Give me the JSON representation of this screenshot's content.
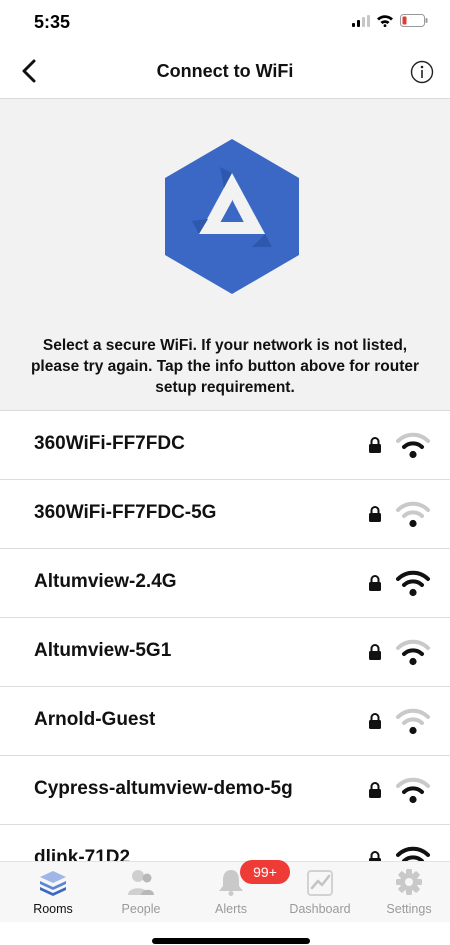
{
  "status_bar": {
    "time": "5:35",
    "icons": [
      "signal-icon",
      "wifi-status-icon",
      "battery-low-icon"
    ],
    "battery_color": "#e53935"
  },
  "nav": {
    "title": "Connect to WiFi",
    "back_icon": "chevron-left-icon",
    "info_icon": "info-circle-icon"
  },
  "hero": {
    "logo": "altumview-logo",
    "logo_color": "#3a68c4",
    "instructions": "Select a secure WiFi. If your network is not listed, please try again. Tap the info button above for router setup requirement."
  },
  "networks": [
    {
      "name": "360WiFi-FF7FDC",
      "secured": true,
      "signal": 0.66
    },
    {
      "name": "360WiFi-FF7FDC-5G",
      "secured": true,
      "signal": 0.33
    },
    {
      "name": "Altumview-2.4G",
      "secured": true,
      "signal": 1.0
    },
    {
      "name": "Altumview-5G1",
      "secured": true,
      "signal": 0.66
    },
    {
      "name": "Arnold-Guest",
      "secured": true,
      "signal": 0.33
    },
    {
      "name": "Cypress-altumview-demo-5g",
      "secured": true,
      "signal": 0.66
    },
    {
      "name": "dlink-71D2",
      "secured": true,
      "signal": 1.0
    }
  ],
  "tab_bar": {
    "tabs": [
      {
        "label": "Rooms",
        "icon": "rooms-layers-icon",
        "active": true
      },
      {
        "label": "People",
        "icon": "people-icon",
        "active": false
      },
      {
        "label": "Alerts",
        "icon": "bell-icon",
        "active": false
      },
      {
        "label": "Dashboard",
        "icon": "chart-line-icon",
        "active": false
      },
      {
        "label": "Settings",
        "icon": "gear-icon",
        "active": false
      }
    ],
    "alerts_badge": "99+",
    "active_color": "#3a68c4"
  }
}
